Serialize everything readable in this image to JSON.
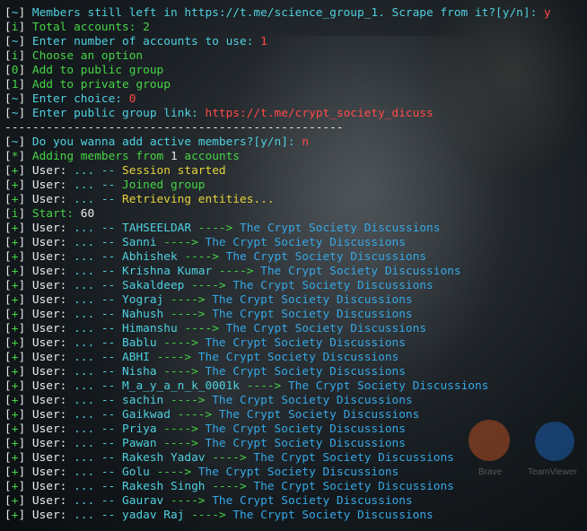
{
  "colors": {
    "bracket": "#e8e8e8",
    "cyan": "#4fd1e0",
    "green": "#46d446",
    "red": "#ff4a4a",
    "yellow": "#e6d23c",
    "blue": "#36a8e6"
  },
  "background": {
    "dock_labels": [
      "Brave",
      "TeamViewer"
    ],
    "dock_icons": [
      "brave-icon",
      "teamviewer-icon"
    ]
  },
  "lines": [
    {
      "tag": "~",
      "tag_color": "cyan",
      "parts": [
        {
          "t": "Members still left in https://t.me/science_group_1. Scrape from it?[y/n]: ",
          "c": "cyan"
        },
        {
          "t": "y",
          "c": "red"
        }
      ]
    },
    {
      "tag": "i",
      "tag_color": "green",
      "parts": [
        {
          "t": "Total accounts: 2",
          "c": "green"
        }
      ]
    },
    {
      "tag": "~",
      "tag_color": "cyan",
      "parts": [
        {
          "t": "Enter number of accounts to use: ",
          "c": "cyan"
        },
        {
          "t": "1",
          "c": "red"
        }
      ]
    },
    {
      "tag": "i",
      "tag_color": "green",
      "parts": [
        {
          "t": "Choose an option",
          "c": "green"
        }
      ]
    },
    {
      "tag": "0",
      "tag_color": "green",
      "parts": [
        {
          "t": "Add to public group",
          "c": "green"
        }
      ]
    },
    {
      "tag": "1",
      "tag_color": "green",
      "parts": [
        {
          "t": "Add to private group",
          "c": "green"
        }
      ]
    },
    {
      "tag": "~",
      "tag_color": "cyan",
      "parts": [
        {
          "t": "Enter choice: ",
          "c": "cyan"
        },
        {
          "t": "0",
          "c": "red"
        }
      ]
    },
    {
      "tag": "~",
      "tag_color": "cyan",
      "parts": [
        {
          "t": "Enter public group link: ",
          "c": "cyan"
        },
        {
          "t": "https://t.me/crypt_society_dicuss",
          "c": "red"
        }
      ]
    },
    {
      "raw": "-------------------------------------------------",
      "c": "white"
    },
    {
      "tag": "~",
      "tag_color": "cyan",
      "parts": [
        {
          "t": "Do you wanna add active members?[y/n]: ",
          "c": "cyan"
        },
        {
          "t": "n",
          "c": "red"
        }
      ]
    },
    {
      "tag": "*",
      "tag_color": "green",
      "parts": [
        {
          "t": "Adding members from ",
          "c": "green"
        },
        {
          "t": "1",
          "c": "white"
        },
        {
          "t": " accounts",
          "c": "green"
        }
      ]
    },
    {
      "tag": "+",
      "tag_color": "green",
      "parts": [
        {
          "t": "User: ",
          "c": "white"
        },
        {
          "t": "... -- ",
          "c": "cyan"
        },
        {
          "t": "Session started",
          "c": "yellow"
        }
      ]
    },
    {
      "tag": "+",
      "tag_color": "green",
      "parts": [
        {
          "t": "User: ",
          "c": "white"
        },
        {
          "t": "... -- ",
          "c": "cyan"
        },
        {
          "t": "Joined group",
          "c": "green"
        }
      ]
    },
    {
      "tag": "+",
      "tag_color": "green",
      "parts": [
        {
          "t": "User: ",
          "c": "white"
        },
        {
          "t": "... -- ",
          "c": "cyan"
        },
        {
          "t": "Retrieving entities...",
          "c": "yellow"
        }
      ]
    },
    {
      "tag": "i",
      "tag_color": "green",
      "parts": [
        {
          "t": "Start: ",
          "c": "green"
        },
        {
          "t": "60",
          "c": "white"
        }
      ]
    },
    {
      "tag": "+",
      "tag_color": "green",
      "parts": [
        {
          "t": "User: ",
          "c": "white"
        },
        {
          "t": "... -- ",
          "c": "cyan"
        },
        {
          "t": "TAHSEELDAR",
          "c": "cyan"
        },
        {
          "t": " ----> ",
          "c": "green"
        },
        {
          "t": "The Crypt Society Discussions",
          "c": "blue"
        }
      ]
    },
    {
      "tag": "+",
      "tag_color": "green",
      "parts": [
        {
          "t": "User: ",
          "c": "white"
        },
        {
          "t": "... -- ",
          "c": "cyan"
        },
        {
          "t": "Sanni",
          "c": "cyan"
        },
        {
          "t": " ----> ",
          "c": "green"
        },
        {
          "t": "The Crypt Society Discussions",
          "c": "blue"
        }
      ]
    },
    {
      "tag": "+",
      "tag_color": "green",
      "parts": [
        {
          "t": "User: ",
          "c": "white"
        },
        {
          "t": "... -- ",
          "c": "cyan"
        },
        {
          "t": "Abhishek",
          "c": "cyan"
        },
        {
          "t": " ----> ",
          "c": "green"
        },
        {
          "t": "The Crypt Society Discussions",
          "c": "blue"
        }
      ]
    },
    {
      "tag": "+",
      "tag_color": "green",
      "parts": [
        {
          "t": "User: ",
          "c": "white"
        },
        {
          "t": "... -- ",
          "c": "cyan"
        },
        {
          "t": "Krishna Kumar",
          "c": "cyan"
        },
        {
          "t": " ----> ",
          "c": "green"
        },
        {
          "t": "The Crypt Society Discussions",
          "c": "blue"
        }
      ]
    },
    {
      "tag": "+",
      "tag_color": "green",
      "parts": [
        {
          "t": "User: ",
          "c": "white"
        },
        {
          "t": "... -- ",
          "c": "cyan"
        },
        {
          "t": "Sakaldeep",
          "c": "cyan"
        },
        {
          "t": " ----> ",
          "c": "green"
        },
        {
          "t": "The Crypt Society Discussions",
          "c": "blue"
        }
      ]
    },
    {
      "tag": "+",
      "tag_color": "green",
      "parts": [
        {
          "t": "User: ",
          "c": "white"
        },
        {
          "t": "... -- ",
          "c": "cyan"
        },
        {
          "t": "Yograj",
          "c": "cyan"
        },
        {
          "t": " ----> ",
          "c": "green"
        },
        {
          "t": "The Crypt Society Discussions",
          "c": "blue"
        }
      ]
    },
    {
      "tag": "+",
      "tag_color": "green",
      "parts": [
        {
          "t": "User: ",
          "c": "white"
        },
        {
          "t": "... -- ",
          "c": "cyan"
        },
        {
          "t": "Nahush",
          "c": "cyan"
        },
        {
          "t": " ----> ",
          "c": "green"
        },
        {
          "t": "The Crypt Society Discussions",
          "c": "blue"
        }
      ]
    },
    {
      "tag": "+",
      "tag_color": "green",
      "parts": [
        {
          "t": "User: ",
          "c": "white"
        },
        {
          "t": "... -- ",
          "c": "cyan"
        },
        {
          "t": "Himanshu",
          "c": "cyan"
        },
        {
          "t": " ----> ",
          "c": "green"
        },
        {
          "t": "The Crypt Society Discussions",
          "c": "blue"
        }
      ]
    },
    {
      "tag": "+",
      "tag_color": "green",
      "parts": [
        {
          "t": "User: ",
          "c": "white"
        },
        {
          "t": "... -- ",
          "c": "cyan"
        },
        {
          "t": "Bablu",
          "c": "cyan"
        },
        {
          "t": " ----> ",
          "c": "green"
        },
        {
          "t": "The Crypt Society Discussions",
          "c": "blue"
        }
      ]
    },
    {
      "tag": "+",
      "tag_color": "green",
      "parts": [
        {
          "t": "User: ",
          "c": "white"
        },
        {
          "t": "... -- ",
          "c": "cyan"
        },
        {
          "t": "ABHI",
          "c": "cyan"
        },
        {
          "t": " ----> ",
          "c": "green"
        },
        {
          "t": "The Crypt Society Discussions",
          "c": "blue"
        }
      ]
    },
    {
      "tag": "+",
      "tag_color": "green",
      "parts": [
        {
          "t": "User: ",
          "c": "white"
        },
        {
          "t": "... -- ",
          "c": "cyan"
        },
        {
          "t": "Nisha",
          "c": "cyan"
        },
        {
          "t": " ----> ",
          "c": "green"
        },
        {
          "t": "The Crypt Society Discussions",
          "c": "blue"
        }
      ]
    },
    {
      "tag": "+",
      "tag_color": "green",
      "parts": [
        {
          "t": "User: ",
          "c": "white"
        },
        {
          "t": "... -- ",
          "c": "cyan"
        },
        {
          "t": "M_a_y_a_n_k_0001k",
          "c": "cyan"
        },
        {
          "t": " ----> ",
          "c": "green"
        },
        {
          "t": "The Crypt Society Discussions",
          "c": "blue"
        }
      ]
    },
    {
      "tag": "+",
      "tag_color": "green",
      "parts": [
        {
          "t": "User: ",
          "c": "white"
        },
        {
          "t": "... -- ",
          "c": "cyan"
        },
        {
          "t": "sachin",
          "c": "cyan"
        },
        {
          "t": " ----> ",
          "c": "green"
        },
        {
          "t": "The Crypt Society Discussions",
          "c": "blue"
        }
      ]
    },
    {
      "tag": "+",
      "tag_color": "green",
      "parts": [
        {
          "t": "User: ",
          "c": "white"
        },
        {
          "t": "... -- ",
          "c": "cyan"
        },
        {
          "t": "Gaikwad",
          "c": "cyan"
        },
        {
          "t": " ----> ",
          "c": "green"
        },
        {
          "t": "The Crypt Society Discussions",
          "c": "blue"
        }
      ]
    },
    {
      "tag": "+",
      "tag_color": "green",
      "parts": [
        {
          "t": "User: ",
          "c": "white"
        },
        {
          "t": "... -- ",
          "c": "cyan"
        },
        {
          "t": "Priya",
          "c": "cyan"
        },
        {
          "t": " ----> ",
          "c": "green"
        },
        {
          "t": "The Crypt Society Discussions",
          "c": "blue"
        }
      ]
    },
    {
      "tag": "+",
      "tag_color": "green",
      "parts": [
        {
          "t": "User: ",
          "c": "white"
        },
        {
          "t": "... -- ",
          "c": "cyan"
        },
        {
          "t": "Pawan",
          "c": "cyan"
        },
        {
          "t": " ----> ",
          "c": "green"
        },
        {
          "t": "The Crypt Society Discussions",
          "c": "blue"
        }
      ]
    },
    {
      "tag": "+",
      "tag_color": "green",
      "parts": [
        {
          "t": "User: ",
          "c": "white"
        },
        {
          "t": "... -- ",
          "c": "cyan"
        },
        {
          "t": "Rakesh Yadav",
          "c": "cyan"
        },
        {
          "t": " ----> ",
          "c": "green"
        },
        {
          "t": "The Crypt Society Discussions",
          "c": "blue"
        }
      ]
    },
    {
      "tag": "+",
      "tag_color": "green",
      "parts": [
        {
          "t": "User: ",
          "c": "white"
        },
        {
          "t": "... -- ",
          "c": "cyan"
        },
        {
          "t": "Golu",
          "c": "cyan"
        },
        {
          "t": " ----> ",
          "c": "green"
        },
        {
          "t": "The Crypt Society Discussions",
          "c": "blue"
        }
      ]
    },
    {
      "tag": "+",
      "tag_color": "green",
      "parts": [
        {
          "t": "User: ",
          "c": "white"
        },
        {
          "t": "... -- ",
          "c": "cyan"
        },
        {
          "t": "Rakesh Singh",
          "c": "cyan"
        },
        {
          "t": " ----> ",
          "c": "green"
        },
        {
          "t": "The Crypt Society Discussions",
          "c": "blue"
        }
      ]
    },
    {
      "tag": "+",
      "tag_color": "green",
      "parts": [
        {
          "t": "User: ",
          "c": "white"
        },
        {
          "t": "... -- ",
          "c": "cyan"
        },
        {
          "t": "Gaurav",
          "c": "cyan"
        },
        {
          "t": " ----> ",
          "c": "green"
        },
        {
          "t": "The Crypt Society Discussions",
          "c": "blue"
        }
      ]
    },
    {
      "tag": "+",
      "tag_color": "green",
      "parts": [
        {
          "t": "User: ",
          "c": "white"
        },
        {
          "t": "... -- ",
          "c": "cyan"
        },
        {
          "t": "yadav Raj",
          "c": "cyan"
        },
        {
          "t": " ----> ",
          "c": "green"
        },
        {
          "t": "The Crypt Society Discussions",
          "c": "blue"
        }
      ]
    }
  ]
}
